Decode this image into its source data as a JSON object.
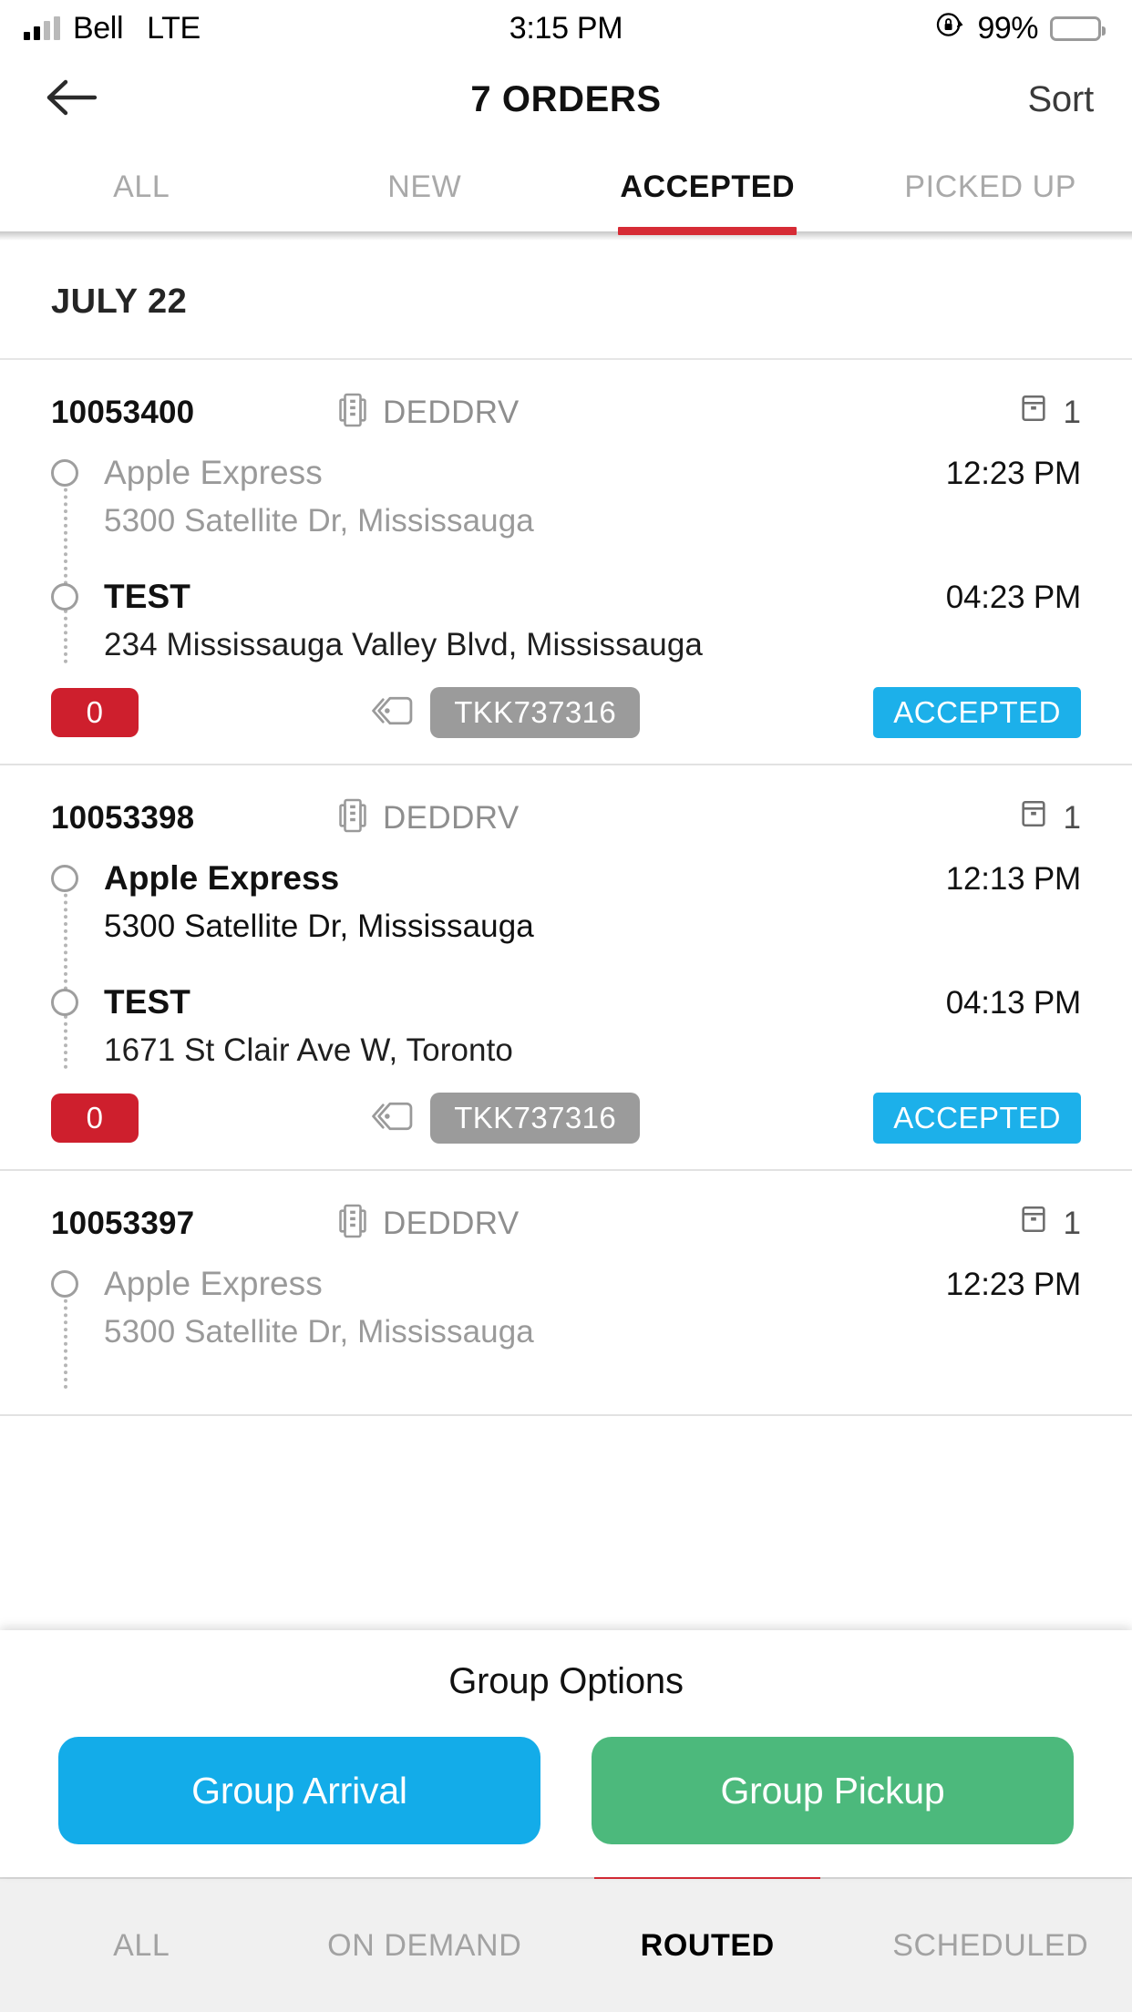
{
  "status_bar": {
    "carrier": "Bell",
    "network": "LTE",
    "time": "3:15 PM",
    "battery_percent": "99%",
    "orientation_lock_icon": "rotation-lock-icon",
    "battery_icon": "battery-icon",
    "signal_icon": "signal-bars-icon"
  },
  "nav": {
    "back_icon": "back-arrow-icon",
    "title": "7 ORDERS",
    "sort_label": "Sort"
  },
  "top_tabs": {
    "items": [
      {
        "label": "ALL",
        "active": false
      },
      {
        "label": "NEW",
        "active": false
      },
      {
        "label": "ACCEPTED",
        "active": true
      },
      {
        "label": "PICKED UP",
        "active": false
      }
    ],
    "active_indicator_color": "#d62b35"
  },
  "list": {
    "date_header": "JULY 22",
    "orders": [
      {
        "id": "10053400",
        "service_icon": "building-icon",
        "service": "DEDDRV",
        "pieces_icon": "package-icon",
        "pieces": "1",
        "pickup": {
          "name": "Apple Express",
          "address": "5300 Satellite Dr, Mississauga",
          "time": "12:23 PM",
          "style": "muted"
        },
        "dropoff": {
          "name": "TEST",
          "address": "234 Mississauga Valley Blvd, Mississauga",
          "time": "04:23 PM",
          "style": "solid"
        },
        "count_badge": "0",
        "tracking_icon": "tag-icon",
        "tracking": "TKK737316",
        "status": "ACCEPTED"
      },
      {
        "id": "10053398",
        "service_icon": "building-icon",
        "service": "DEDDRV",
        "pieces_icon": "package-icon",
        "pieces": "1",
        "pickup": {
          "name": "Apple Express",
          "address": "5300 Satellite Dr, Mississauga",
          "time": "12:13 PM",
          "style": "normal"
        },
        "dropoff": {
          "name": "TEST",
          "address": "1671 St Clair Ave W, Toronto",
          "time": "04:13 PM",
          "style": "solid"
        },
        "count_badge": "0",
        "tracking_icon": "tag-icon",
        "tracking": "TKK737316",
        "status": "ACCEPTED"
      },
      {
        "id": "10053397",
        "service_icon": "building-icon",
        "service": "DEDDRV",
        "pieces_icon": "package-icon",
        "pieces": "1",
        "pickup": {
          "name": "Apple Express",
          "address": "5300 Satellite Dr, Mississauga",
          "time": "12:23 PM",
          "style": "muted"
        }
      }
    ]
  },
  "group_panel": {
    "title": "Group Options",
    "arrival_label": "Group Arrival",
    "pickup_label": "Group Pickup",
    "arrival_color": "#13ace9",
    "pickup_color": "#4cb97c"
  },
  "bottom_tabs": {
    "items": [
      {
        "label": "ALL",
        "active": false
      },
      {
        "label": "ON DEMAND",
        "active": false
      },
      {
        "label": "ROUTED",
        "active": true
      },
      {
        "label": "SCHEDULED",
        "active": false
      }
    ],
    "active_indicator_color": "#d62b35"
  },
  "colors": {
    "accent_red": "#d62b35",
    "badge_red": "#ce1f2d",
    "status_blue": "#1cb0ea",
    "tracking_gray": "#9b9b9b"
  }
}
